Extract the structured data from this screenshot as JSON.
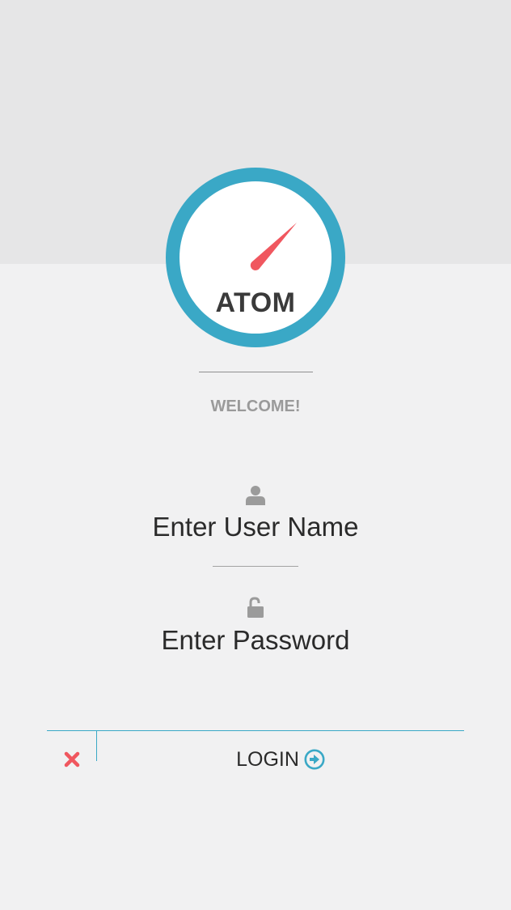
{
  "app": {
    "logo_text": "ATOM",
    "welcome": "WELCOME!"
  },
  "form": {
    "username_label": "Enter User Name",
    "password_label": "Enter Password"
  },
  "actions": {
    "login_label": "LOGIN"
  },
  "icons": {
    "logo": "gauge-icon",
    "username": "user-icon",
    "password": "unlock-icon",
    "cancel": "close-icon",
    "login": "arrow-right-circle-icon"
  },
  "colors": {
    "accent": "#3aa8c6",
    "needle": "#f0575f",
    "cancel": "#f0575f",
    "background": "#f1f1f2",
    "header_band": "#e6e6e7",
    "icon_gray": "#9b9b9b"
  }
}
